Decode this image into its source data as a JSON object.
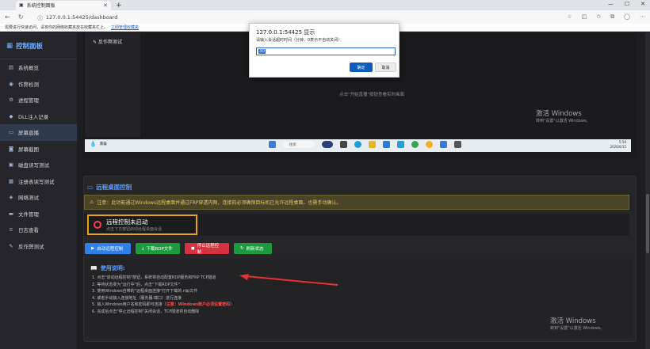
{
  "browser": {
    "tab_title": "系统控制面板",
    "url": "127.0.0.1:54425/dashboard",
    "infobar_text": "需要进行快速访问，请将你的网络收藏夹放在收藏夹栏上。",
    "infobar_link": "立即管理收藏夹"
  },
  "sidebar": {
    "brand": "控制面板",
    "items": [
      {
        "label": "系统概览",
        "icon": "chart-icon"
      },
      {
        "label": "作弊检测",
        "icon": "user-shield-icon"
      },
      {
        "label": "进程管理",
        "icon": "gear-icon"
      },
      {
        "label": "DLL注入记录",
        "icon": "shield-icon"
      },
      {
        "label": "屏幕直播",
        "icon": "monitor-icon"
      },
      {
        "label": "屏幕截图",
        "icon": "camera-icon"
      },
      {
        "label": "磁盘读写测试",
        "icon": "disk-icon"
      },
      {
        "label": "注册表读写测试",
        "icon": "registry-icon"
      },
      {
        "label": "网络测试",
        "icon": "network-icon"
      },
      {
        "label": "文件管理",
        "icon": "folder-icon"
      },
      {
        "label": "日志查看",
        "icon": "log-icon"
      },
      {
        "label": "反作弊测试",
        "icon": "shield-check-icon"
      }
    ],
    "active_index": 4
  },
  "preview": {
    "side_title": "反作弊测试",
    "hint": "点击\"开始直播\"按钮查看实时画面",
    "activate_title": "激活 Windows",
    "activate_sub": "转到\"设置\"以激活 Windows。",
    "taskbar": {
      "weather": "雾霾",
      "search": "搜索",
      "time": "5:56",
      "date": "2026/6/15"
    }
  },
  "remote": {
    "title": "远程桌面控制",
    "warning": "注意：此功能通过Windows远程桌面并通过FRP穿透内网，连接前必须确保目标机已允许远程桌面，也需手动确认。",
    "status_title": "远程控制未启动",
    "status_sub": "点击下方按钮启动远程桌面会话",
    "buttons": {
      "start": "启动远程控制",
      "download": "下载RDP文件",
      "stop": "停止远程控制",
      "refresh": "刷新状态"
    },
    "usage_title": "使用说明:",
    "steps": [
      "1. 点击\"启动远程控制\"按钮，系统将自动配置RDP服务和FRP TCP隧道",
      "2. 等待状态变为\"运行中\"后，点击\"下载RDP文件\"",
      "3. 使用Windows自带的\"远程桌面连接\"打开下载的.rdp文件",
      "4. 或者手动输入连接地址（服务器:端口）进行连接",
      "5. 输入Windows用户名和密码即可连接（",
      "6. 完成后点击\"停止远程控制\"关闭会话，TCP隧道将自动删除"
    ],
    "step5_note": "注意：Windows账户必须设置密码",
    "step5_tail": "）",
    "activate_title": "激活 Windows",
    "activate_sub": "转到\"设置\"以激活 Windows。"
  },
  "dialog": {
    "title": "127.0.0.1:54425 显示",
    "prompt": "请输入会话超时时间（分钟，0表示不自动关闭）：",
    "value": "30",
    "ok": "确定",
    "cancel": "取消"
  },
  "colors": {
    "accent": "#5aa0ff",
    "warning": "#e8c75a",
    "status_ring": "#ff3b4a",
    "highlight_box": "#e8a40c"
  }
}
